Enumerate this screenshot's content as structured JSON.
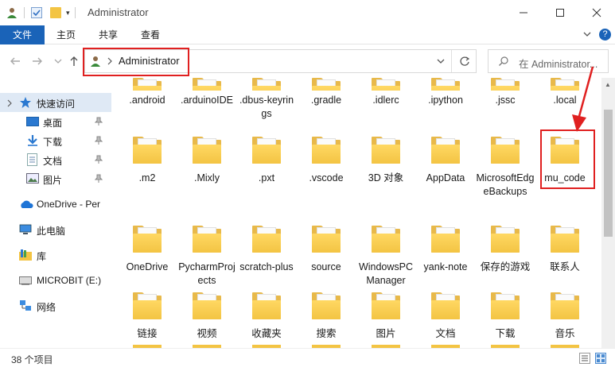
{
  "window": {
    "title": "Administrator",
    "controls": [
      "minimize",
      "maximize",
      "close"
    ]
  },
  "ribbon": {
    "tabs": [
      "文件",
      "主页",
      "共享",
      "查看"
    ]
  },
  "address": {
    "path": "Administrator",
    "search_placeholder": "在 Administrator..."
  },
  "nav": {
    "items": [
      {
        "label": "快速访问",
        "icon": "star-icon"
      },
      {
        "label": "桌面",
        "icon": "desktop-icon"
      },
      {
        "label": "下载",
        "icon": "download-icon"
      },
      {
        "label": "文档",
        "icon": "document-icon"
      },
      {
        "label": "图片",
        "icon": "pictures-icon"
      },
      {
        "label": "OneDrive - Per",
        "icon": "onedrive-icon"
      },
      {
        "label": "此电脑",
        "icon": "computer-icon"
      },
      {
        "label": "库",
        "icon": "library-icon"
      },
      {
        "label": "MICROBIT (E:)",
        "icon": "drive-icon"
      },
      {
        "label": "网络",
        "icon": "network-icon"
      }
    ]
  },
  "files": {
    "row1": [
      ".android",
      ".arduinoIDE",
      ".dbus-keyrings",
      ".gradle",
      ".idlerc",
      ".ipython",
      ".jssc",
      ".local"
    ],
    "row2": [
      ".m2",
      ".Mixly",
      ".pxt",
      ".vscode",
      "3D 对象",
      "AppData",
      "MicrosoftEdgeBackups",
      "mu_code"
    ],
    "row3": [
      "OneDrive",
      "PycharmProjects",
      "scratch-plus",
      "source",
      "WindowsPCManager",
      "yank-note",
      "保存的游戏",
      "联系人"
    ],
    "row4": [
      "链接",
      "视频",
      "收藏夹",
      "搜索",
      "图片",
      "文档",
      "下载",
      "音乐"
    ]
  },
  "status": {
    "count": "38 个项目"
  },
  "colors": {
    "accent": "#1a63b8",
    "highlight": "#e02020",
    "folder": "#f3c443",
    "selected_nav": "#dfe9f5"
  }
}
